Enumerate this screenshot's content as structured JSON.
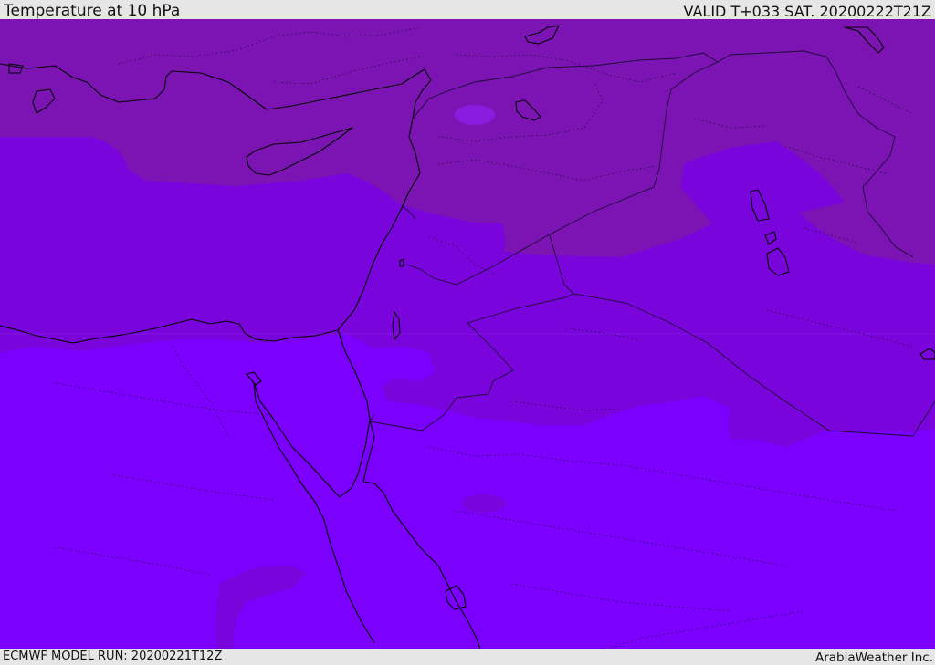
{
  "header": {
    "title": "Temperature at 10 hPa",
    "valid_time": "VALID T+033 SAT. 20200222T21Z"
  },
  "footer": {
    "model_run": "ECMWF MODEL RUN: 20200221T12Z",
    "credit": "ArabiaWeather Inc."
  },
  "map": {
    "colors": {
      "coldest_band": "#7c14b4",
      "middle_band": "#7a04dc",
      "warmest_band": "#7c00fe",
      "warm_patch": "#8a1ce0",
      "coastline": "#000000",
      "borders": "#1a0b33"
    }
  }
}
